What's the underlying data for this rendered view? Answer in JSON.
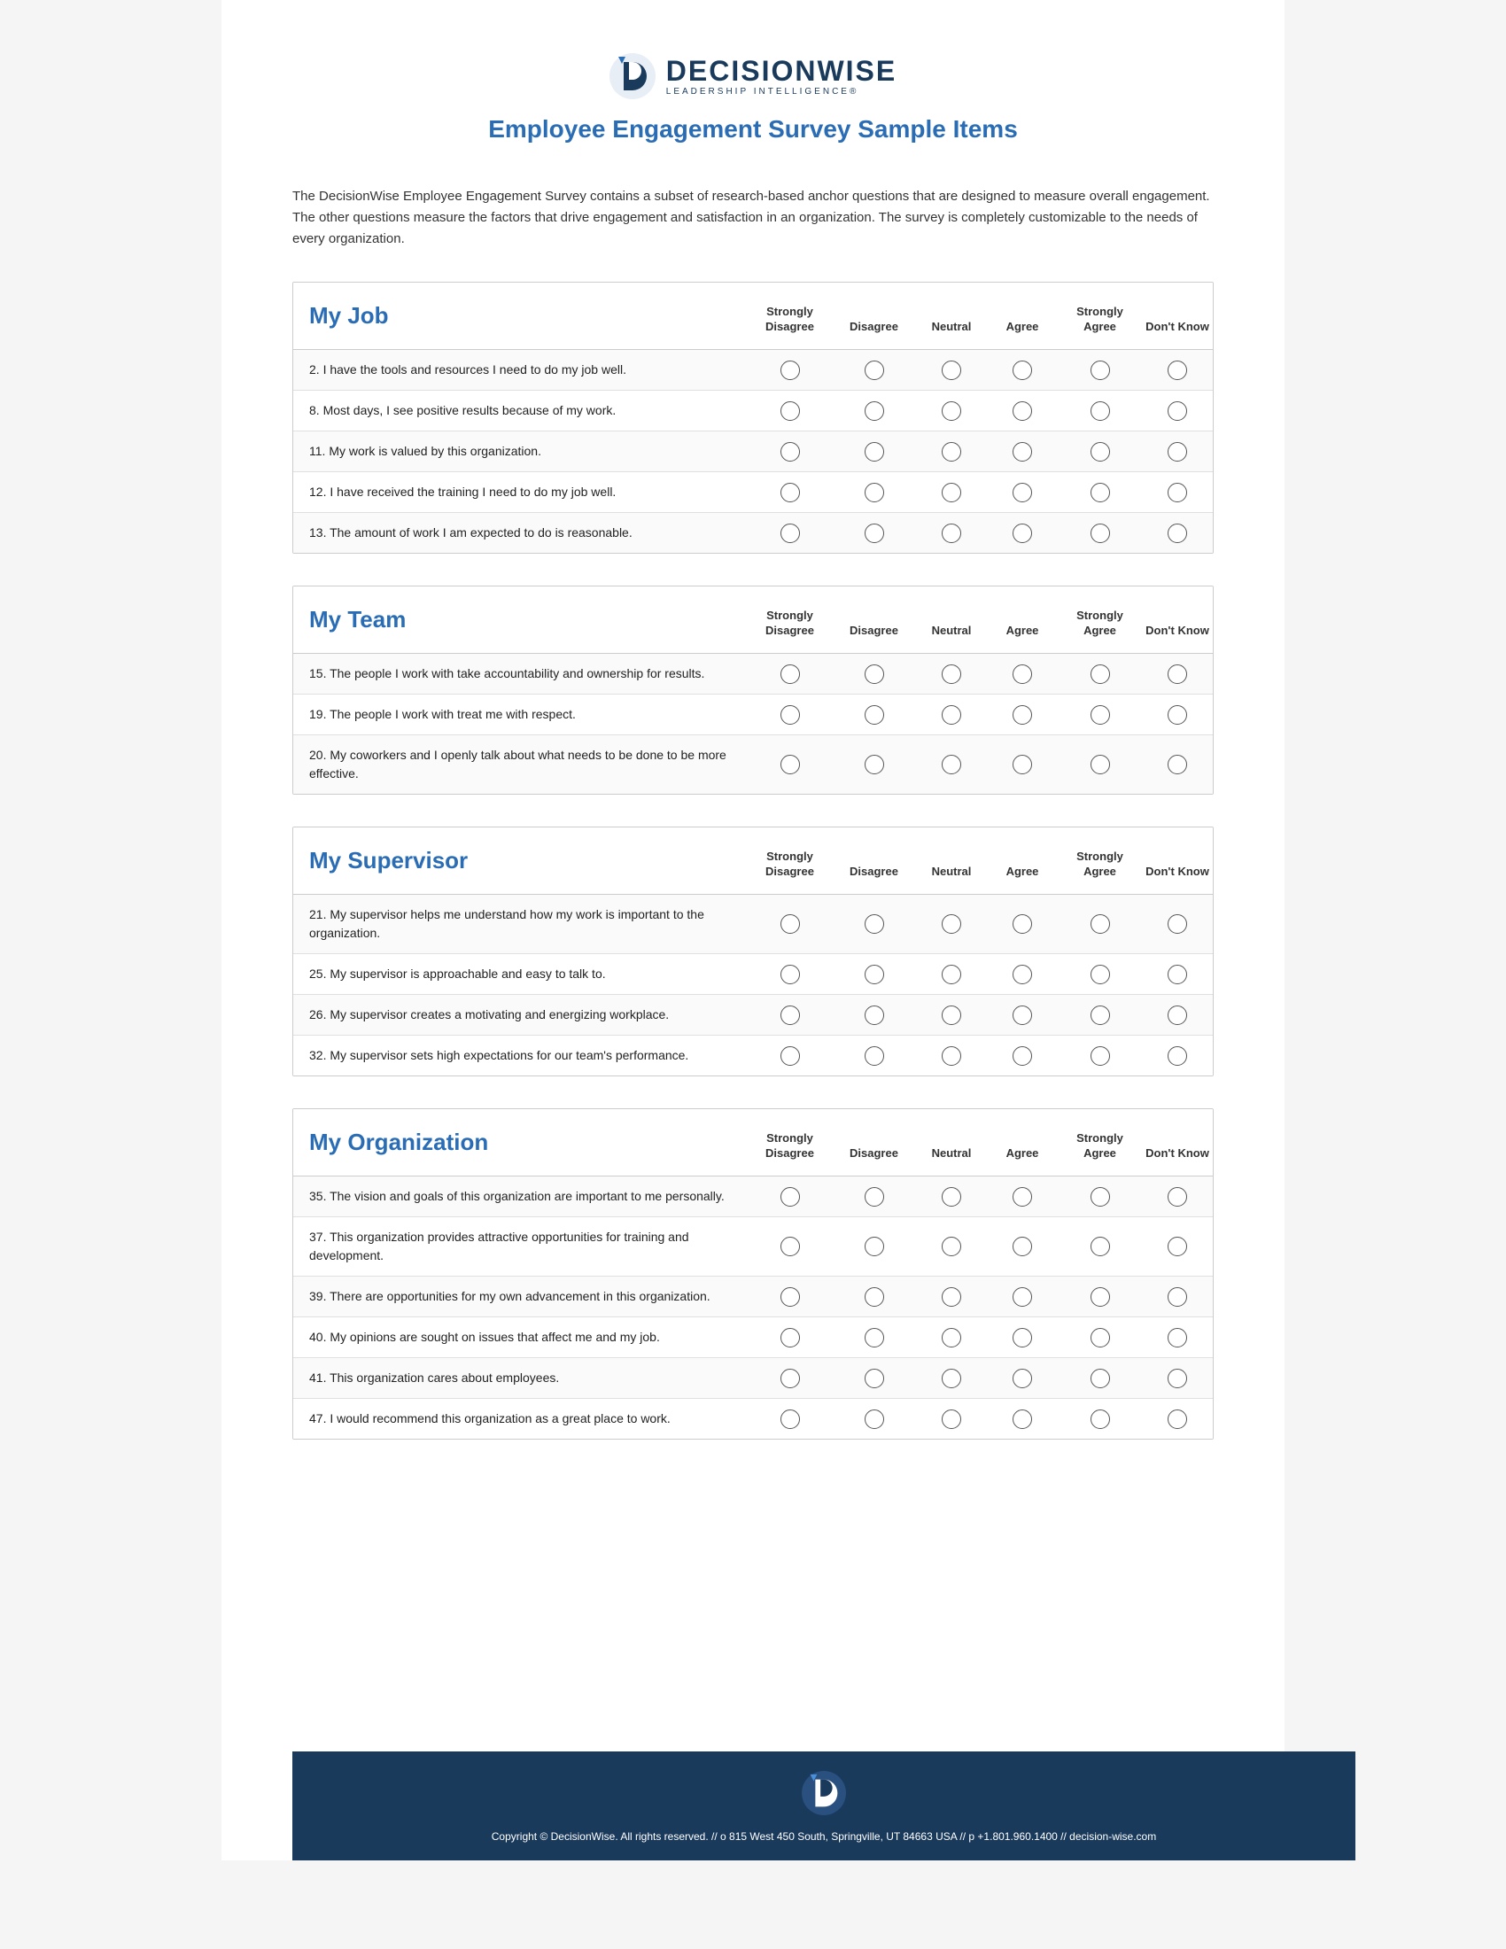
{
  "logo": {
    "name": "DECISIONWISE",
    "subtitle": "LEADERSHIP INTELLIGENCE®"
  },
  "page_title": "Employee Engagement Survey Sample Items",
  "intro": "The DecisionWise Employee Engagement Survey contains a subset of research-based anchor questions that are designed to measure overall engagement. The other questions measure the factors that drive engagement and satisfaction in an organization. The survey is completely customizable to the needs of every organization.",
  "columns": {
    "strongly_disagree": "Strongly Disagree",
    "disagree": "Disagree",
    "neutral": "Neutral",
    "agree": "Agree",
    "strongly_agree": "Strongly Agree",
    "dont_know": "Don't Know"
  },
  "sections": [
    {
      "id": "my-job",
      "title": "My Job",
      "rows": [
        "2. I have the tools and resources I need to do my job well.",
        "8. Most days, I see positive results because of my work.",
        "11. My work is valued by this organization.",
        "12. I have received the training I need to do my job well.",
        "13. The amount of work I am expected to do is reasonable."
      ]
    },
    {
      "id": "my-team",
      "title": "My Team",
      "rows": [
        "15. The people I work with take accountability and ownership for results.",
        "19. The people I work with treat me with respect.",
        "20. My coworkers and I openly talk about what needs to be done to be more effective."
      ]
    },
    {
      "id": "my-supervisor",
      "title": "My Supervisor",
      "rows": [
        "21. My supervisor helps me understand how my work is important to the organization.",
        "25. My supervisor is approachable and easy to talk to.",
        "26. My supervisor creates a motivating and energizing workplace.",
        "32. My supervisor sets high expectations for our team's performance."
      ]
    },
    {
      "id": "my-organization",
      "title": "My Organization",
      "rows": [
        "35. The vision and goals of this organization are important to me personally.",
        "37. This organization provides attractive opportunities for training and development.",
        "39. There are opportunities for my own advancement in this organization.",
        "40. My opinions are sought on issues that affect me and my job.",
        "41. This organization cares about employees.",
        "47. I would recommend this organization as a great place to work."
      ]
    }
  ],
  "footer": {
    "copyright": "Copyright © DecisionWise. All rights reserved. // o 815 West 450 South, Springville, UT 84663 USA // p +1.801.960.1400 // decision-wise.com"
  }
}
